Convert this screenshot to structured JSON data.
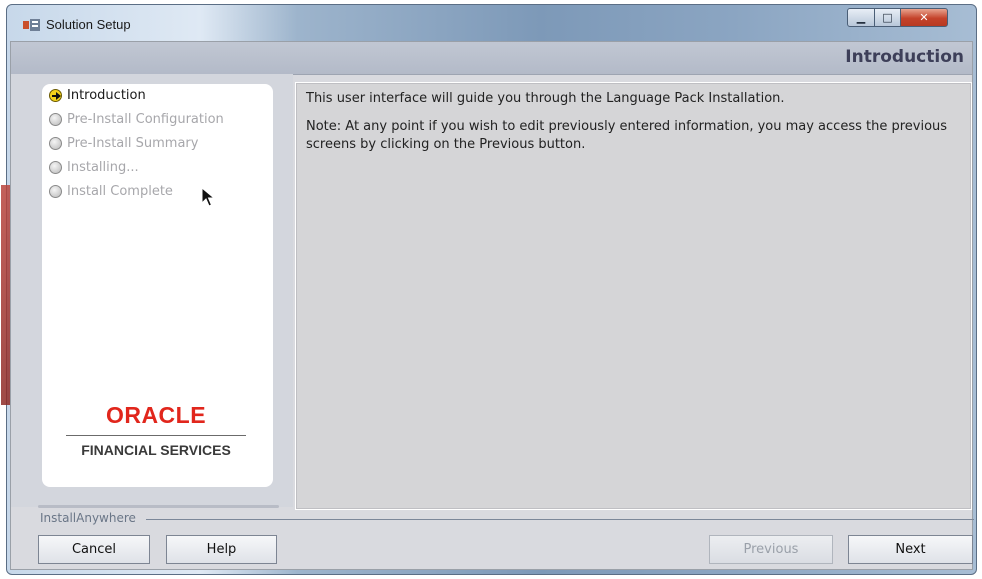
{
  "window": {
    "title": "Solution Setup",
    "controls": {
      "minimize": "▁",
      "maximize": "□",
      "close": "✕"
    }
  },
  "header": {
    "title": "Introduction"
  },
  "steps": [
    {
      "label": "Introduction",
      "state": "current"
    },
    {
      "label": "Pre-Install Configuration",
      "state": "pending"
    },
    {
      "label": "Pre-Install Summary",
      "state": "pending"
    },
    {
      "label": "Installing...",
      "state": "pending"
    },
    {
      "label": "Install Complete",
      "state": "pending"
    }
  ],
  "logo": {
    "brand": "ORACLE",
    "sub": "FINANCIAL SERVICES"
  },
  "content": {
    "line1": "This user interface will guide you through the Language Pack Installation.",
    "line2": "Note: At any point if you wish to edit previously entered information, you may access the previous screens by clicking on the Previous button."
  },
  "footer": {
    "installer": "InstallAnywhere",
    "cancel": "Cancel",
    "help": "Help",
    "previous": "Previous",
    "next": "Next"
  },
  "colors": {
    "oracle_red": "#e1261c",
    "header_text": "#3d3f59",
    "current_step_arrow": "#f4d31b"
  }
}
